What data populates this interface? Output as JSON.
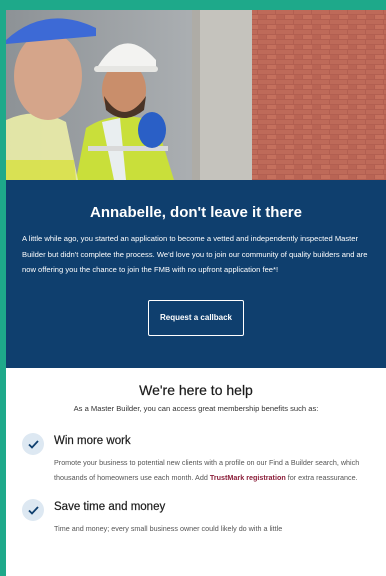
{
  "hero": {
    "alt": "Builder in a hard hat and high-visibility vest on a construction site"
  },
  "banner": {
    "heading": "Annabelle, don't leave it there",
    "body": "A little while ago, you started an application to become a vetted and independently inspected Master Builder but didn't complete the process. We'd love you to join our community of quality builders and are now offering you the chance to join the FMB with no upfront application fee*!",
    "cta_label": "Request a callback"
  },
  "help": {
    "heading": "We're here to help",
    "intro": "As a Master Builder, you can access great membership benefits such as:",
    "benefits": [
      {
        "title": "Win more work",
        "text": "Promote your business to potential new clients with a profile on our Find a Builder search, which thousands of homeowners use each month. Add ",
        "link": "TrustMark registration",
        "text_after": " for extra reassurance."
      },
      {
        "title": "Save time and money",
        "text": "Time and money; every small business owner could likely do with a little"
      }
    ]
  },
  "colors": {
    "outer_border": "#1ea98a",
    "banner_bg": "#0f3f6e",
    "link": "#8b1f3a",
    "check_bg": "#dde8f2",
    "check_mark": "#0f3f6e"
  }
}
